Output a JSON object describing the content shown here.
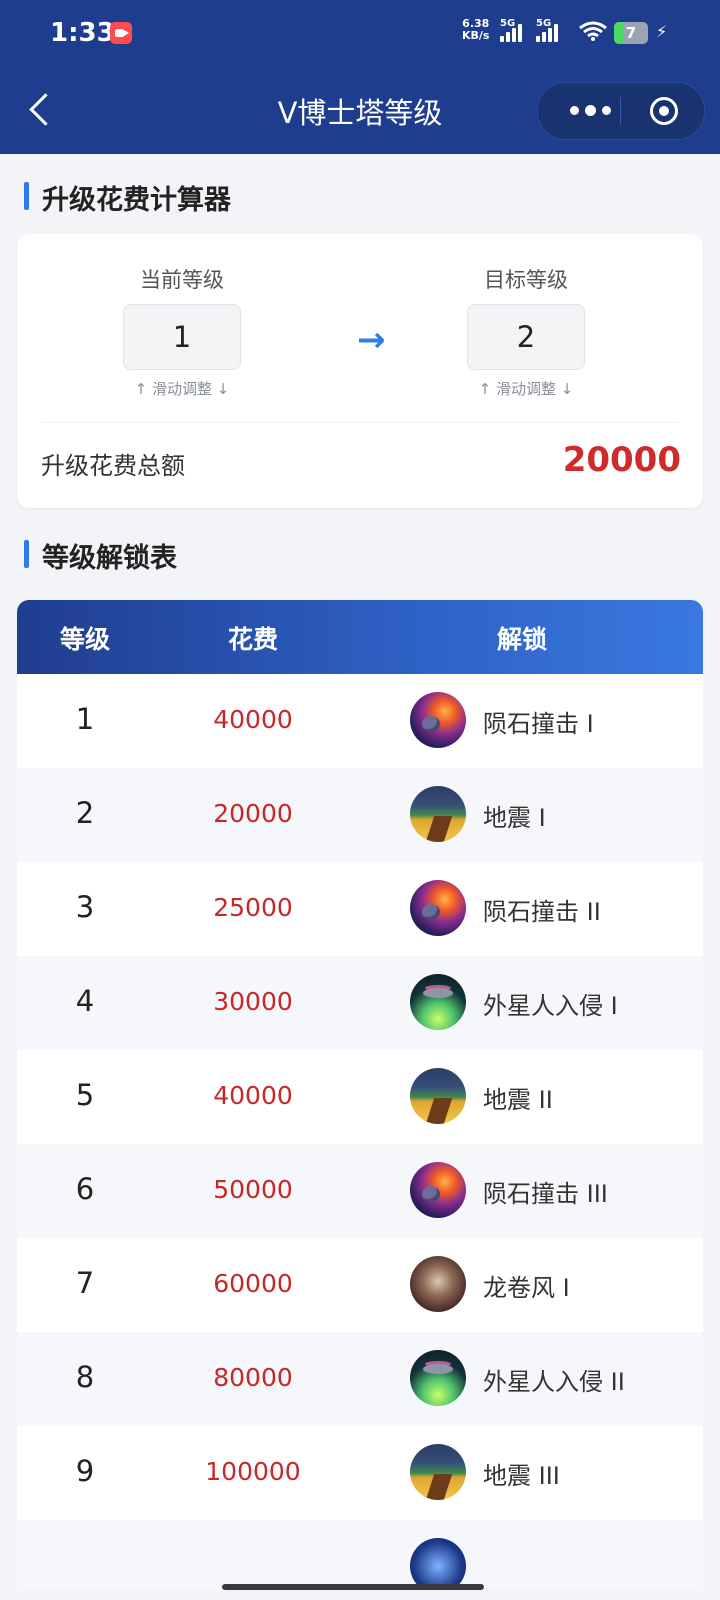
{
  "status": {
    "time": "1:33",
    "speed_value": "6.38",
    "speed_unit": "KB/s",
    "network_1": "5G",
    "network_2": "5G",
    "battery": "7"
  },
  "nav": {
    "title": "V博士塔等级"
  },
  "calculator": {
    "section_title": "升级花费计算器",
    "current_label": "当前等级",
    "current_value": "1",
    "target_label": "目标等级",
    "target_value": "2",
    "hint": "↑ 滑动调整 ↓",
    "arrow": "→",
    "total_label": "升级花费总额",
    "total_value": "20000"
  },
  "table": {
    "section_title": "等级解锁表",
    "headers": {
      "level": "等级",
      "cost": "花费",
      "unlock": "解锁"
    },
    "rows": [
      {
        "level": "1",
        "cost": "40000",
        "unlock": "陨石撞击 I",
        "icon": "meteor-icon"
      },
      {
        "level": "2",
        "cost": "20000",
        "unlock": "地震 I",
        "icon": "earthquake-icon"
      },
      {
        "level": "3",
        "cost": "25000",
        "unlock": "陨石撞击 II",
        "icon": "meteor-icon"
      },
      {
        "level": "4",
        "cost": "30000",
        "unlock": "外星人入侵 I",
        "icon": "ufo-icon"
      },
      {
        "level": "5",
        "cost": "40000",
        "unlock": "地震 II",
        "icon": "earthquake-icon"
      },
      {
        "level": "6",
        "cost": "50000",
        "unlock": "陨石撞击 III",
        "icon": "meteor-icon"
      },
      {
        "level": "7",
        "cost": "60000",
        "unlock": "龙卷风 I",
        "icon": "tornado-icon"
      },
      {
        "level": "8",
        "cost": "80000",
        "unlock": "外星人入侵 II",
        "icon": "ufo-icon"
      },
      {
        "level": "9",
        "cost": "100000",
        "unlock": "地震 III",
        "icon": "earthquake-icon"
      },
      {
        "level": "",
        "cost": "",
        "unlock": "",
        "icon": "lightning-icon"
      }
    ]
  },
  "colors": {
    "header_bg": "#1f3d8f",
    "accent_blue": "#2f7be8",
    "cost_red": "#c6282a"
  }
}
